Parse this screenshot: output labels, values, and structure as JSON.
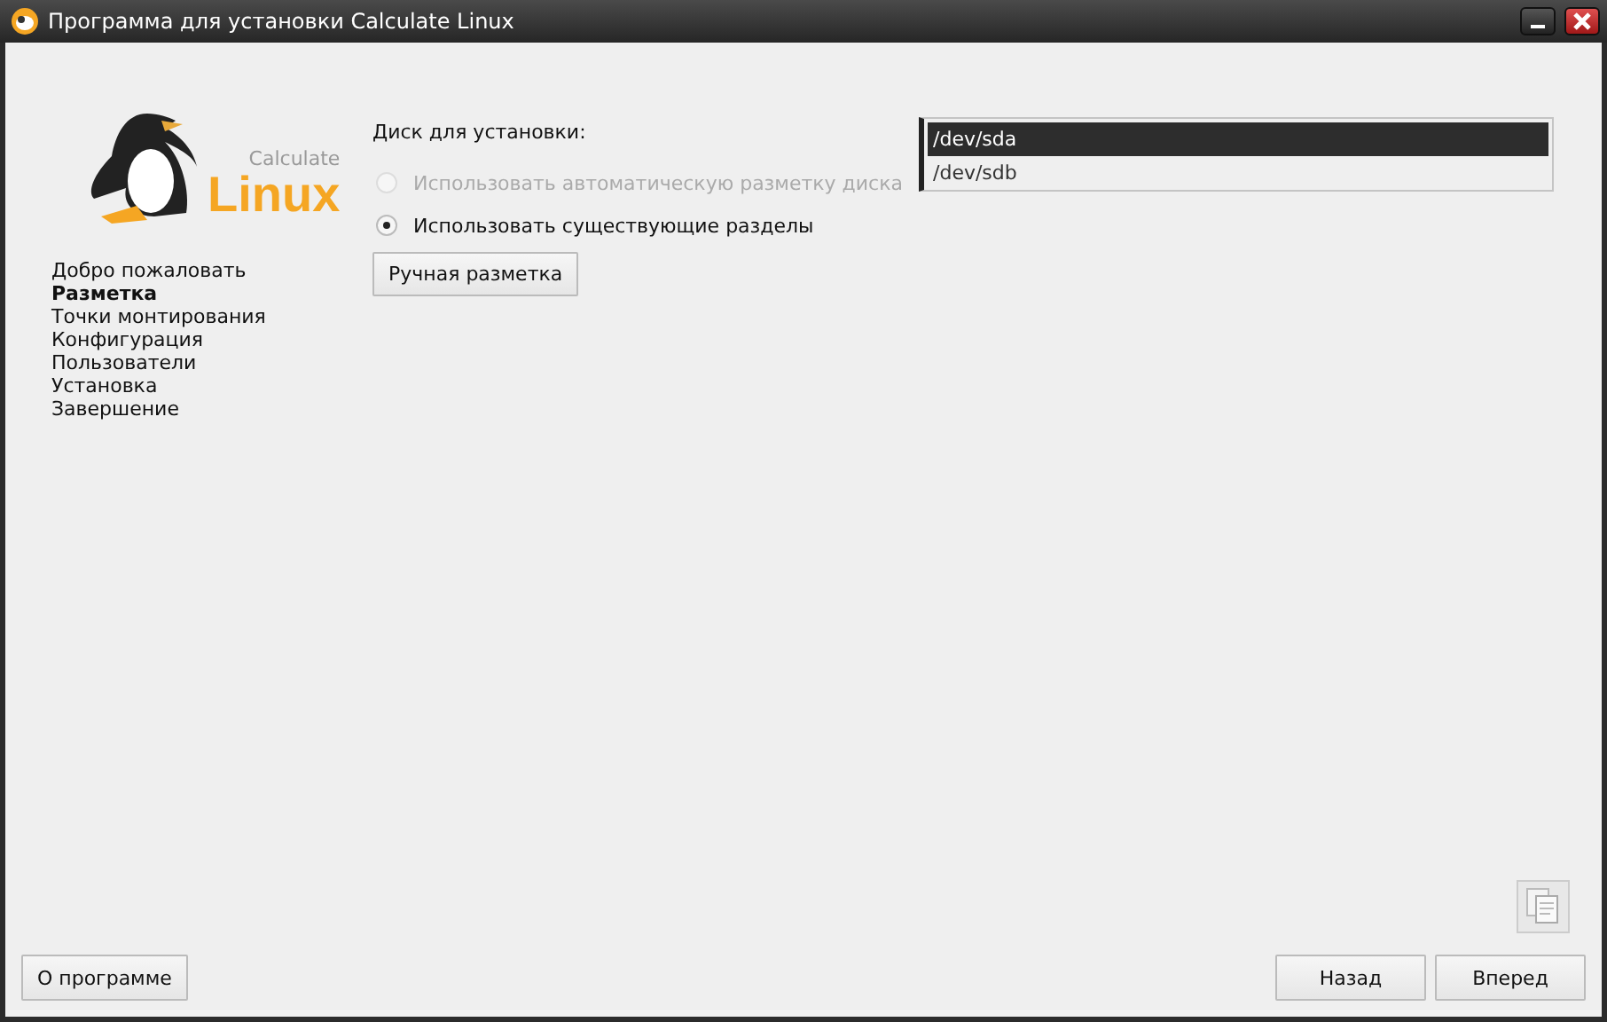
{
  "window": {
    "title": "Программа для установки Calculate Linux"
  },
  "logo": {
    "small": "Calculate",
    "big": "Linux"
  },
  "steps": [
    {
      "label": "Добро пожаловать",
      "selected": false
    },
    {
      "label": "Разметка",
      "selected": true
    },
    {
      "label": "Точки монтирования",
      "selected": false
    },
    {
      "label": "Конфигурация",
      "selected": false
    },
    {
      "label": "Пользователи",
      "selected": false
    },
    {
      "label": "Установка",
      "selected": false
    },
    {
      "label": "Завершение",
      "selected": false
    }
  ],
  "disk_label": "Диск для установки:",
  "options": [
    {
      "label": "Использовать автоматическую разметку диска",
      "selected": false,
      "disabled": true
    },
    {
      "label": "Использовать существующие разделы",
      "selected": true,
      "disabled": false
    }
  ],
  "manual_button": "Ручная разметка",
  "disks": [
    {
      "label": "/dev/sda",
      "selected": true
    },
    {
      "label": "/dev/sdb",
      "selected": false
    }
  ],
  "buttons": {
    "about": "О программе",
    "back": "Назад",
    "next": "Вперед"
  }
}
